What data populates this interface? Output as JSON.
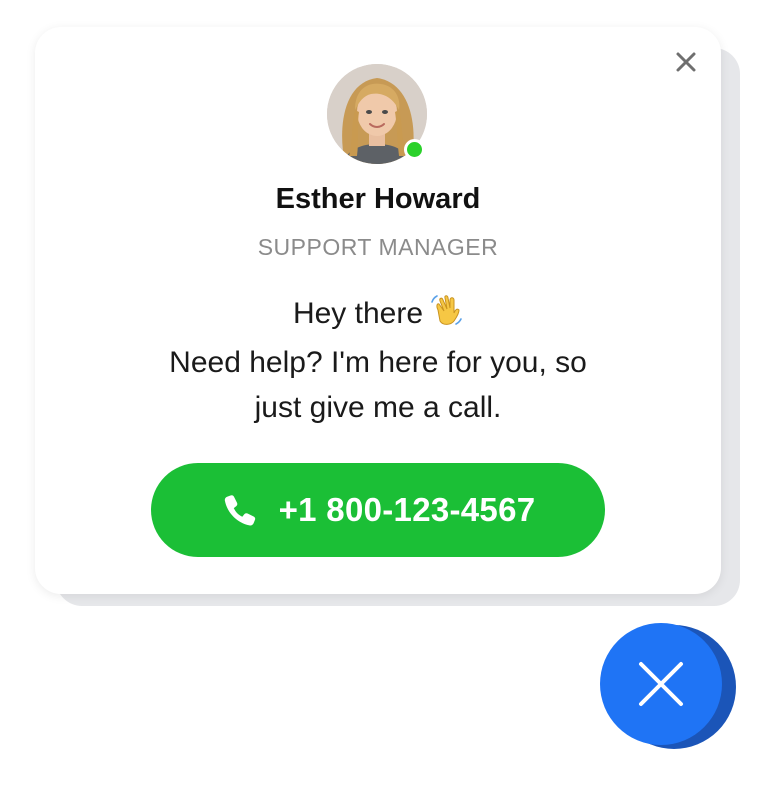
{
  "card": {
    "name": "Esther Howard",
    "role": "SUPPORT MANAGER",
    "status": "online",
    "message_line1": "Hey there",
    "message_line2": "Need help? I'm here for you, so",
    "message_line3": "just give me a call.",
    "phone_number": "+1 800-123-4567",
    "close_icon": "close-icon"
  },
  "fab": {
    "icon": "close-icon"
  },
  "colors": {
    "accent_green": "#1bbf36",
    "online_dot": "#2bd12b",
    "fab_blue": "#1f74f5",
    "fab_shadow": "#1b55b8",
    "role_gray": "#8b8b8b"
  }
}
